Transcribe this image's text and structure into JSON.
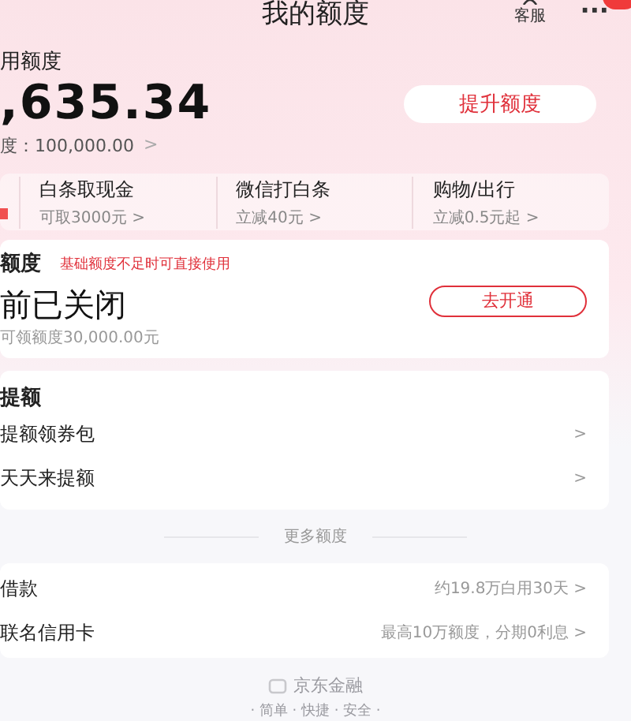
{
  "header": {
    "title": "我的额度",
    "service_label": "客服",
    "more": "···"
  },
  "summary": {
    "label": "用额度",
    "amount": ",635.34",
    "total": "度：100,000.00",
    "total_arrow": ">",
    "raise_button": "提升额度"
  },
  "shortcuts": [
    {
      "title": "白条取现金",
      "subtitle": "可取3000元 >"
    },
    {
      "title": "微信打白条",
      "subtitle": "立减40元 >"
    },
    {
      "title": "购物/出行",
      "subtitle": "立减0.5元起 >"
    }
  ],
  "extra_card": {
    "title": "额度",
    "note": "基础额度不足时可直接使用",
    "status": "前已关闭",
    "detail": "可领额度30,000.00元",
    "button": "去开通"
  },
  "raise_card": {
    "title": "提额",
    "rows": [
      {
        "label": "提额领券包",
        "arrow": ">"
      },
      {
        "label": "天天来提额",
        "arrow": ">"
      }
    ]
  },
  "more_divider": "更多额度",
  "more_rows": [
    {
      "label": "借款",
      "value": "约19.8万白用30天 >"
    },
    {
      "label": "联名信用卡",
      "value": "最高10万额度，分期0利息 >"
    }
  ],
  "footer": {
    "brand": "京东金融",
    "slogan": "· 简单 · 快捷 · 安全 ·"
  }
}
